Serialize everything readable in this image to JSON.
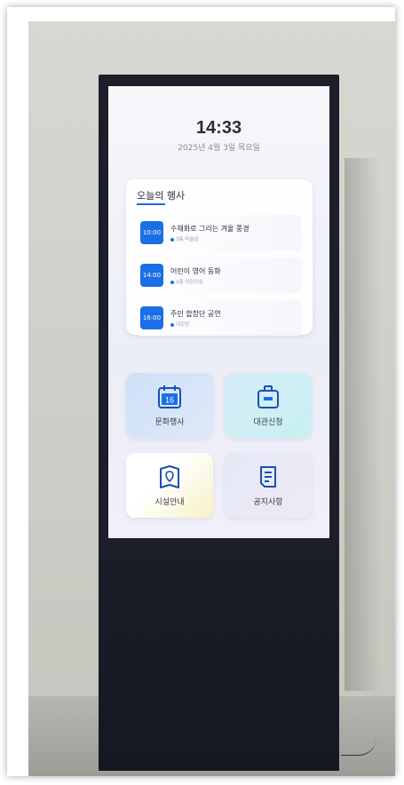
{
  "clock": {
    "time": "14:33",
    "date": "2025년 4월 3일 목요일"
  },
  "events": {
    "title": "오늘의 행사",
    "items": [
      {
        "time": "10:00",
        "title": "수채화로 그리는 겨울 풍경",
        "location": "3층 미술실"
      },
      {
        "time": "14:00",
        "title": "어린이 영어 동화",
        "location": "2층 어린이실"
      },
      {
        "time": "16:00",
        "title": "주민 합창단 공연",
        "location": "대강당"
      }
    ]
  },
  "menu": {
    "culture": {
      "label": "문화행사",
      "icon": "calendar-icon",
      "day": "16"
    },
    "rental": {
      "label": "대관신청",
      "icon": "briefcase-icon"
    },
    "facility": {
      "label": "시설안내",
      "icon": "map-icon"
    },
    "notice": {
      "label": "공지사항",
      "icon": "document-icon"
    }
  },
  "colors": {
    "accent": "#1b6fe6",
    "kiosk_body": "#1c1e2a"
  }
}
